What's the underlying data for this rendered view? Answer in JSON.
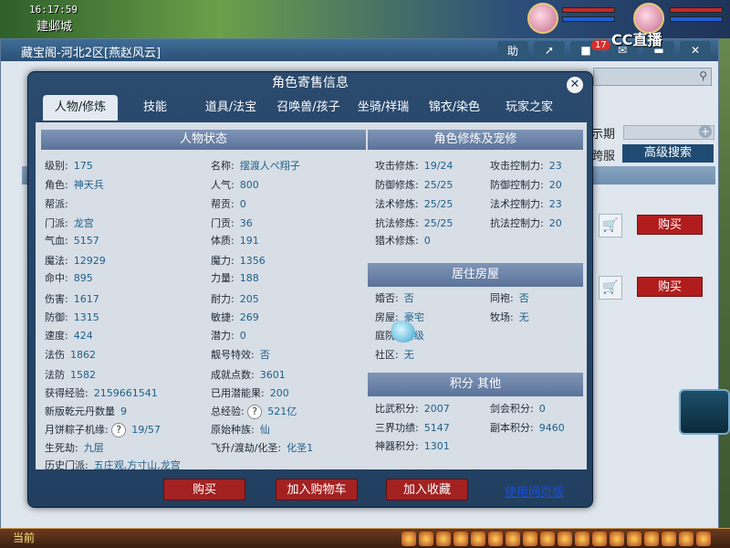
{
  "hud": {
    "time": "16:17:59",
    "location": "建邺城"
  },
  "back_window": {
    "title": "藏宝阁-河北2区[燕赵风云]",
    "tools": [
      "助"
    ],
    "notif_count": "17",
    "stream_logo": "CC直播",
    "side_label_1": "示期",
    "side_label_2": "跨服",
    "adv_search": "高级搜索",
    "buy_label": "购买",
    "bottom_label": "当前"
  },
  "dialog": {
    "title": "角色寄售信息",
    "close": "✕",
    "tabs": [
      "人物/修炼",
      "技能",
      "道具/法宝",
      "召唤兽/孩子",
      "坐骑/祥瑞",
      "锦衣/染色",
      "玩家之家"
    ]
  },
  "status": {
    "heading": "人物状态",
    "left": [
      {
        "k": "级别:",
        "v": "175"
      },
      {
        "k": "角色:",
        "v": "神天兵"
      },
      {
        "k": "帮派:",
        "v": ""
      },
      {
        "k": "门派:",
        "v": "龙宫"
      },
      {
        "k": "气血:",
        "v": "5157"
      },
      {
        "k": "魔法:",
        "v": "12929"
      },
      {
        "k": "命中:",
        "v": "895"
      },
      {
        "k": "伤害:",
        "v": "1617"
      },
      {
        "k": "防御:",
        "v": "1315"
      },
      {
        "k": "速度:",
        "v": "424"
      },
      {
        "k": "法伤",
        "v": "1862"
      },
      {
        "k": "法防",
        "v": "1582"
      },
      {
        "k": "获得经验:",
        "v": "2159661541"
      },
      {
        "k": "新版乾元丹数量",
        "v": "9"
      },
      {
        "k": "月饼粽子机缘:",
        "v": "19/57"
      },
      {
        "k": "生死劫:",
        "v": "九层"
      },
      {
        "k": "历史门派:",
        "v": "五庄观,方寸山,龙宫"
      }
    ],
    "right": [
      {
        "k": "名称:",
        "v": "摆渡人ぺ翔子"
      },
      {
        "k": "人气:",
        "v": "800"
      },
      {
        "k": "帮贡:",
        "v": "0"
      },
      {
        "k": "门贡:",
        "v": "36"
      },
      {
        "k": "体质:",
        "v": "191"
      },
      {
        "k": "魔力:",
        "v": "1356"
      },
      {
        "k": "力量:",
        "v": "188"
      },
      {
        "k": "耐力:",
        "v": "205"
      },
      {
        "k": "敏捷:",
        "v": "269"
      },
      {
        "k": "潜力:",
        "v": "0"
      },
      {
        "k": "靓号特效:",
        "v": "否"
      },
      {
        "k": "成就点数:",
        "v": "3601"
      },
      {
        "k": "已用潜能果:",
        "v": "200"
      },
      {
        "k": "总经验:",
        "v": "521亿"
      },
      {
        "k": "原始种族:",
        "v": "仙"
      },
      {
        "k": "飞升/渡劫/化圣:",
        "v": "化圣1"
      }
    ]
  },
  "cultivation": {
    "heading": "角色修炼及宠修",
    "left": [
      {
        "k": "攻击修炼:",
        "v": "19/24"
      },
      {
        "k": "防御修炼:",
        "v": "25/25"
      },
      {
        "k": "法术修炼:",
        "v": "25/25"
      },
      {
        "k": "抗法修炼:",
        "v": "25/25"
      },
      {
        "k": "猎术修炼:",
        "v": "0"
      }
    ],
    "right": [
      {
        "k": "攻击控制力:",
        "v": "23"
      },
      {
        "k": "防御控制力:",
        "v": "20"
      },
      {
        "k": "法术控制力:",
        "v": "23"
      },
      {
        "k": "抗法控制力:",
        "v": "20"
      }
    ]
  },
  "housing": {
    "heading": "居住房屋",
    "left": [
      {
        "k": "婚否:",
        "v": "否"
      },
      {
        "k": "房屋:",
        "v": "豪宅"
      },
      {
        "k": "庭院:",
        "v": "初级"
      },
      {
        "k": "社区:",
        "v": "无"
      }
    ],
    "right": [
      {
        "k": "同袍:",
        "v": "否"
      },
      {
        "k": "牧场:",
        "v": "无"
      }
    ]
  },
  "points": {
    "heading": "积分 其他",
    "left": [
      {
        "k": "比武积分:",
        "v": "2007"
      },
      {
        "k": "三界功绩:",
        "v": "5147"
      },
      {
        "k": "神器积分:",
        "v": "1301"
      }
    ],
    "right": [
      {
        "k": "剑会积分:",
        "v": "0"
      },
      {
        "k": "副本积分:",
        "v": "9460"
      }
    ]
  },
  "buttons": {
    "buy": "购买",
    "add_cart": "加入购物车",
    "add_fav": "加入收藏",
    "web_version": "使用网页版"
  },
  "help_glyph": "?"
}
